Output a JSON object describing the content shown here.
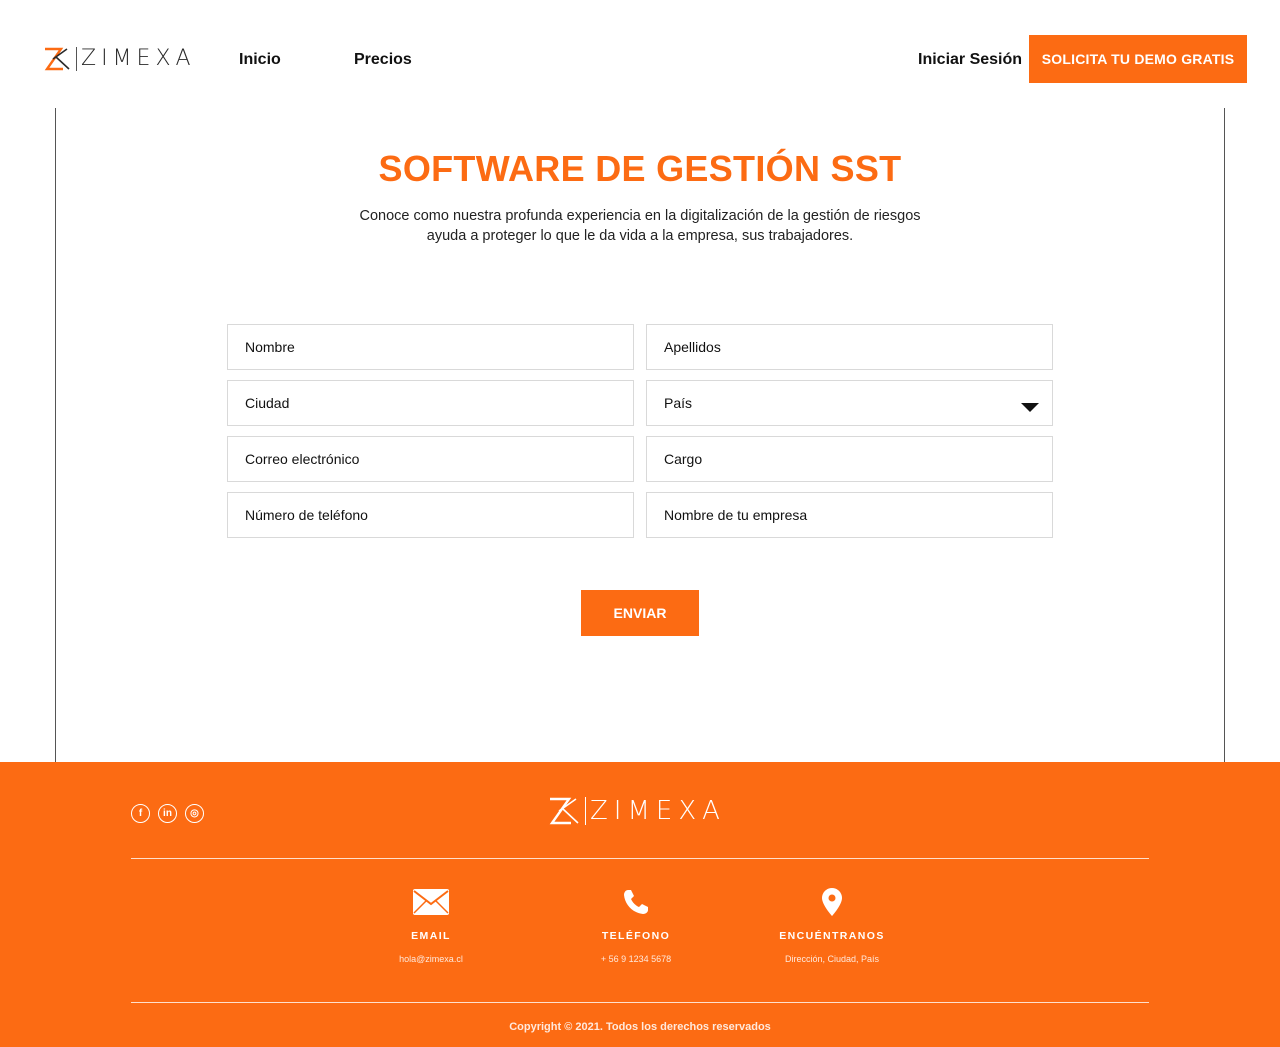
{
  "brand": {
    "name": "ZIMEXA",
    "accent": "#fc6b13"
  },
  "nav": {
    "home": "Inicio",
    "pricing": "Precios",
    "login": "Iniciar Sesión",
    "cta": "SOLICITA TU DEMO GRATIS"
  },
  "hero": {
    "title": "SOFTWARE DE GESTIÓN SST",
    "subtitle": "Conoce como nuestra profunda experiencia en la digitalización de la gestión de riesgos ayuda a proteger lo que le da vida a la empresa, sus trabajadores."
  },
  "form": {
    "first_name": {
      "placeholder": "Nombre"
    },
    "last_name": {
      "placeholder": "Apellidos"
    },
    "city": {
      "placeholder": "Ciudad"
    },
    "country": {
      "selected": "País"
    },
    "email": {
      "placeholder": "Correo electrónico"
    },
    "job_title": {
      "placeholder": "Cargo"
    },
    "phone": {
      "placeholder": "Número de teléfono"
    },
    "company": {
      "placeholder": "Nombre de tu empresa"
    },
    "submit": "ENVIAR"
  },
  "footer": {
    "socials": [
      {
        "icon": "facebook-icon",
        "glyph": "f"
      },
      {
        "icon": "linkedin-icon",
        "glyph": "in"
      },
      {
        "icon": "instagram-icon",
        "glyph": "◎"
      }
    ],
    "email": {
      "title": "EMAIL",
      "value": "hola@zimexa.cl",
      "icon": "envelope-icon"
    },
    "phone": {
      "title": "TELÉFONO",
      "value": "+ 56 9 1234 5678",
      "icon": "phone-icon"
    },
    "location": {
      "title": "ENCUÉNTRANOS",
      "value": "Dirección, Ciudad, País",
      "icon": "map-pin-icon"
    },
    "copyright": "Copyright © 2021. Todos los derechos reservados"
  }
}
